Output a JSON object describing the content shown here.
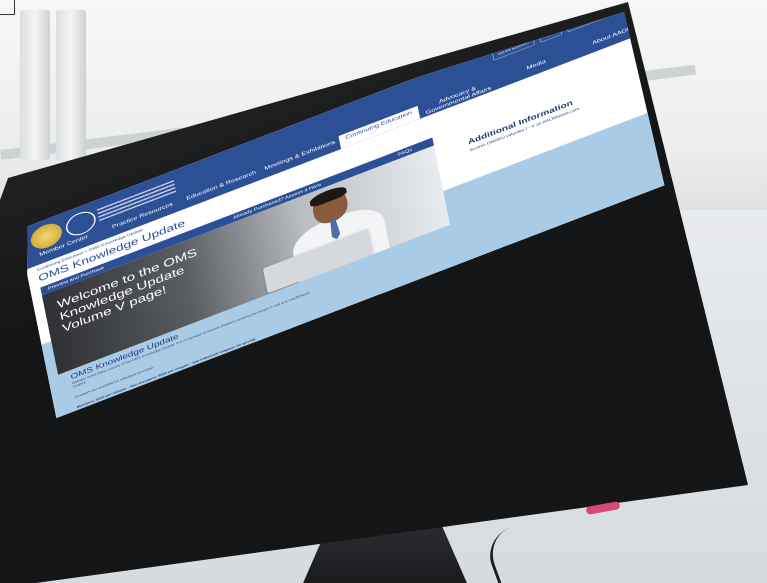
{
  "site": {
    "top_nav": [
      "Member Center",
      "Practice Resources",
      "Education & Research",
      "Meetings & Exhibitions",
      "Continuing Education",
      "Advocacy & Governmental Affairs",
      "Media",
      "About AAOMS"
    ],
    "active_nav": "Continuing Education",
    "utility_nav": [
      "Online Account",
      "Log In",
      "Member Lookup"
    ],
    "breadcrumb": "Continuing Education » OMS Knowledge Update",
    "page_title": "OMS Knowledge Update",
    "tabs": {
      "preview": "Preview and Purchase",
      "purchased": "Already Purchased? Access it Here",
      "faq": "FAQs"
    },
    "hero_text": "Welcome to the OMS Knowledge Update Volume V page!",
    "additional_info": {
      "title": "Additional Information",
      "link_text": "Access OMSKU volumes I - V on AAOMStore.com"
    },
    "oms_section": {
      "title": "OMS Knowledge Update",
      "paragraph_1": "OMSKU is the latest volume of the OMS Knowledge Update. It is comprised of several chapters covering the scope of oral and maxillofacial surgery.",
      "paragraph_2": "Chapters are available for individual purchase.",
      "pricing": "Members: $100 per chapter · Non-members: $200 per chapter · See individual chapters for pricing."
    }
  },
  "colors": {
    "brand_blue": "#2d4f96",
    "light_band": "#a9cbe6",
    "power_led": "#d6487a"
  }
}
